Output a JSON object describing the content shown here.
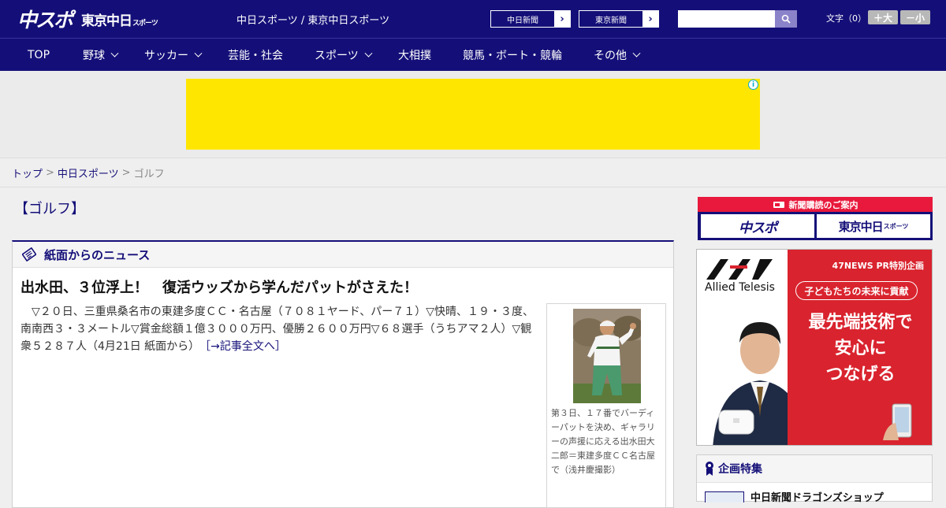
{
  "header": {
    "logo_main": "中スポ",
    "logo_sub": "東京中日",
    "logo_sub_small": "スポーツ",
    "title": "中日スポーツ / 東京中日スポーツ",
    "paper_buttons": [
      {
        "label": "中日新聞",
        "icon": "chevron-right-icon"
      },
      {
        "label": "東京新聞",
        "icon": "chevron-right-icon"
      }
    ],
    "search_icon": "search-icon",
    "font_label": "文字（0）",
    "font_larger": "＋大",
    "font_smaller": "－小"
  },
  "nav": {
    "items": [
      {
        "label": "TOP",
        "dropdown": false
      },
      {
        "label": "野球",
        "dropdown": true
      },
      {
        "label": "サッカー",
        "dropdown": true
      },
      {
        "label": "芸能・社会",
        "dropdown": false
      },
      {
        "label": "スポーツ",
        "dropdown": true
      },
      {
        "label": "大相撲",
        "dropdown": false
      },
      {
        "label": "競馬・ボート・競輪",
        "dropdown": false
      },
      {
        "label": "その他",
        "dropdown": true
      }
    ]
  },
  "ad": {
    "info_glyph": "i",
    "color": "#ffe600"
  },
  "breadcrumb": {
    "items": [
      {
        "label": "トップ",
        "link": true
      },
      {
        "label": "中日スポーツ",
        "link": true
      },
      {
        "label": "ゴルフ",
        "link": false
      }
    ],
    "separator": ">"
  },
  "category": {
    "title": "【ゴルフ】"
  },
  "news": {
    "section_title": "紙面からのニュース",
    "section_icon": "newspaper-icon",
    "headline": "出水田、３位浮上！　復活ウッズから学んだパットがさえた！",
    "body": "▽２０日、三重県桑名市の東建多度ＣＣ・名古屋（７０８１ヤード、パー７１）▽快晴、１９・３度、南南西３・３メートル▽賞金総額１億３０００万円、優勝２６００万円▽６８選手（うちアマ２人）▽観衆５２８７人（4月21日 紙面から）",
    "more_link": "［→記事全文へ］",
    "caption": "第３日、１７番でバーディーパットを決め、ギャラリーの声援に応える出水田大二郎＝東建多度ＣＣ名古屋で（浅井慶撮影）"
  },
  "sidebar": {
    "subscribe": {
      "title": "新聞購読のご案内",
      "left": "中スポ",
      "right": "東京中日",
      "right_small": "スポーツ"
    },
    "pr_ad": {
      "tag": "47NEWS PR特別企画",
      "subtitle": "子どもたちの未来に貢献",
      "lines": [
        "最先端技術で",
        "安心に",
        "つなげる"
      ],
      "brand": "Allied Telesis"
    },
    "feature": {
      "title": "企画特集",
      "icon": "award-ribbon-icon",
      "link": "中日新聞ドラゴンズショップ"
    }
  },
  "colors": {
    "brand_navy": "#140f78",
    "accent_red": "#e8193c",
    "ad_yellow": "#ffe600"
  }
}
